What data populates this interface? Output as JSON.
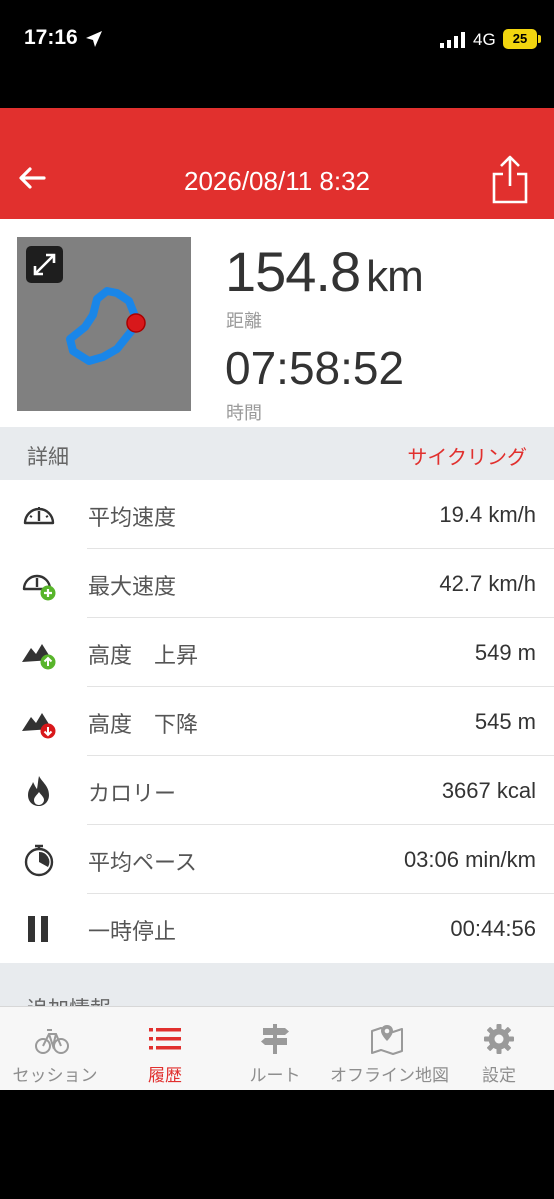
{
  "status_bar": {
    "time": "17:16",
    "network": "4G",
    "battery": "25"
  },
  "header": {
    "title": "2026/08/11 8:32"
  },
  "summary": {
    "distance_value": "154.8",
    "distance_unit": "km",
    "distance_label": "距離",
    "time_value": "07:58:52",
    "time_label": "時間"
  },
  "details": {
    "title": "詳細",
    "activity_type": "サイクリング",
    "rows": [
      {
        "icon": "speedometer-icon",
        "label": "平均速度",
        "value": "19.4 km/h"
      },
      {
        "icon": "speedometer-plus-icon",
        "label": "最大速度",
        "value": "42.7 km/h"
      },
      {
        "icon": "mountain-up-icon",
        "label": "高度　上昇",
        "value": "549 m"
      },
      {
        "icon": "mountain-down-icon",
        "label": "高度　下降",
        "value": "545 m"
      },
      {
        "icon": "flame-icon",
        "label": "カロリー",
        "value": "3667 kcal"
      },
      {
        "icon": "stopwatch-icon",
        "label": "平均ペース",
        "value": "03:06 min/km"
      },
      {
        "icon": "pause-icon",
        "label": "一時停止",
        "value": "00:44:56"
      }
    ]
  },
  "extra": {
    "title": "追加情報"
  },
  "tabs": [
    {
      "label": "セッション",
      "icon": "bicycle-icon",
      "active": false
    },
    {
      "label": "履歴",
      "icon": "list-icon",
      "active": true
    },
    {
      "label": "ルート",
      "icon": "signpost-icon",
      "active": false
    },
    {
      "label": "オフライン地図",
      "icon": "map-icon",
      "active": false
    },
    {
      "label": "設定",
      "icon": "gear-icon",
      "active": false
    }
  ],
  "colors": {
    "accent": "#e1302e",
    "route": "#1a86e8",
    "end_marker": "#d8181b"
  }
}
